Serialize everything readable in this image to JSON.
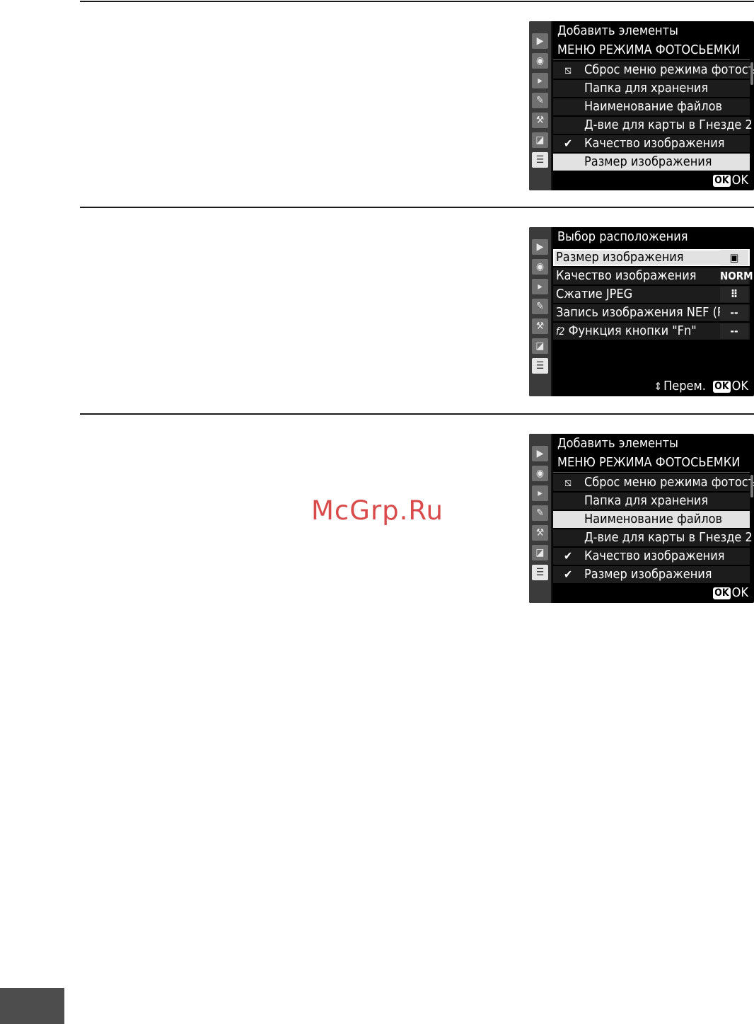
{
  "screen1": {
    "title": "Добавить элементы",
    "subtitle": "МЕНЮ РЕЖИМА ФОТОСЬЕМКИ",
    "items": [
      {
        "mark": "⧅",
        "label": "Сброс меню режима фотосъемки"
      },
      {
        "mark": "",
        "label": "Папка для хранения"
      },
      {
        "mark": "",
        "label": "Наименование файлов"
      },
      {
        "mark": "",
        "label": "Д-вие для карты в Гнезде 2"
      },
      {
        "mark": "✔",
        "label": "Качество изображения"
      },
      {
        "mark": "",
        "label": "Размер изображения"
      }
    ],
    "selected_index": 5,
    "footer_ok_badge": "OK",
    "footer_ok_label": "OK"
  },
  "screen2": {
    "title": "Выбор расположения",
    "items": [
      {
        "label": "Размер изображения",
        "value": "▣"
      },
      {
        "label": "Качество изображения",
        "value": "NORM"
      },
      {
        "label": "Сжатие JPEG",
        "value": "⠿"
      },
      {
        "label": "Запись изображения NEF (RAW)",
        "value": "--"
      },
      {
        "label": "Функция кнопки \"Fn\"",
        "value": "--",
        "prefix": "f2"
      }
    ],
    "selected_index": 0,
    "footer_move_label": "Перем.",
    "footer_ok_badge": "OK",
    "footer_ok_label": "OK"
  },
  "screen3": {
    "title": "Добавить элементы",
    "subtitle": "МЕНЮ РЕЖИМА ФОТОСЬЕМКИ",
    "items": [
      {
        "mark": "⧅",
        "label": "Сброс меню режима фотосъемки"
      },
      {
        "mark": "",
        "label": "Папка для хранения"
      },
      {
        "mark": "",
        "label": "Наименование файлов"
      },
      {
        "mark": "",
        "label": "Д-вие для карты в Гнезде 2"
      },
      {
        "mark": "✔",
        "label": "Качество изображения"
      },
      {
        "mark": "✔",
        "label": "Размер изображения"
      }
    ],
    "selected_index": 2,
    "footer_ok_badge": "OK",
    "footer_ok_label": "OK"
  },
  "tabs": [
    {
      "icon": "playback-icon",
      "glyph": "▶"
    },
    {
      "icon": "camera-icon",
      "glyph": "◉"
    },
    {
      "icon": "movie-icon",
      "glyph": "▸"
    },
    {
      "icon": "pencil-icon",
      "glyph": "✎"
    },
    {
      "icon": "wrench-icon",
      "glyph": "⚒"
    },
    {
      "icon": "retouch-icon",
      "glyph": "◪"
    },
    {
      "icon": "my-menu-icon",
      "glyph": "☰"
    }
  ],
  "watermark": "McGrp.Ru",
  "colors": {
    "screen_bg": "#000000",
    "highlight": "#e2e2e2",
    "tab_active": "#e6e6e6",
    "watermark": "#d94a4a"
  }
}
